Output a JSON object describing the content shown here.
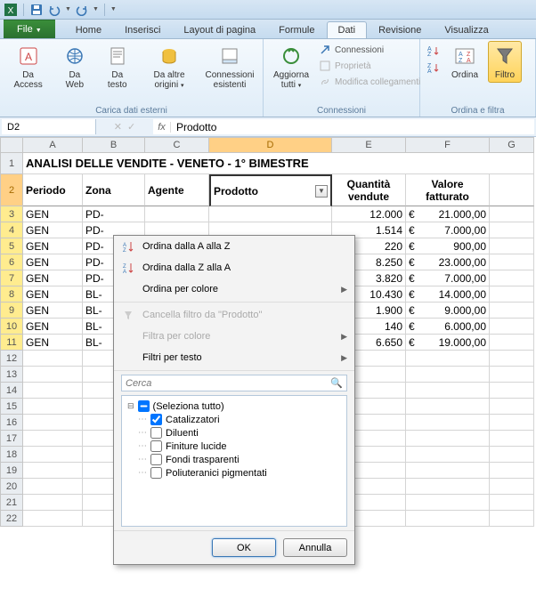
{
  "qat": {
    "save": "save",
    "undo": "undo",
    "redo": "redo"
  },
  "tabs": {
    "file": "File",
    "home": "Home",
    "inserisci": "Inserisci",
    "layout": "Layout di pagina",
    "formule": "Formule",
    "dati": "Dati",
    "revisione": "Revisione",
    "visualizza": "Visualizza"
  },
  "ribbon": {
    "group_carica": "Carica dati esterni",
    "group_connessioni": "Connessioni",
    "group_ordina": "Ordina e filtra",
    "da_access": "Da Access",
    "da_web": "Da Web",
    "da_testo": "Da testo",
    "da_altre": "Da altre origini",
    "conn_esistenti": "Connessioni esistenti",
    "aggiorna": "Aggiorna tutti",
    "connessioni": "Connessioni",
    "proprieta": "Proprietà",
    "modifica_coll": "Modifica collegamenti",
    "ordina": "Ordina",
    "filtro": "Filtro"
  },
  "namebox": "D2",
  "formula": "Prodotto",
  "columns": [
    "A",
    "B",
    "C",
    "D",
    "E",
    "F",
    "G"
  ],
  "sheet": {
    "title": "ANALISI DELLE VENDITE - VENETO - 1° BIMESTRE",
    "headers": {
      "periodo": "Periodo",
      "zona": "Zona",
      "agente": "Agente",
      "prodotto": "Prodotto",
      "qta_l1": "Quantità",
      "qta_l2": "vendute",
      "val_l1": "Valore",
      "val_l2": "fatturato"
    },
    "rows": [
      {
        "periodo": "GEN",
        "zona": "PD-",
        "qta": "12.000",
        "cur": "€",
        "val": "21.000,00"
      },
      {
        "periodo": "GEN",
        "zona": "PD-",
        "qta": "1.514",
        "cur": "€",
        "val": "7.000,00"
      },
      {
        "periodo": "GEN",
        "zona": "PD-",
        "qta": "220",
        "cur": "€",
        "val": "900,00"
      },
      {
        "periodo": "GEN",
        "zona": "PD-",
        "qta": "8.250",
        "cur": "€",
        "val": "23.000,00"
      },
      {
        "periodo": "GEN",
        "zona": "PD-",
        "qta": "3.820",
        "cur": "€",
        "val": "7.000,00"
      },
      {
        "periodo": "GEN",
        "zona": "BL-",
        "qta": "10.430",
        "cur": "€",
        "val": "14.000,00"
      },
      {
        "periodo": "GEN",
        "zona": "BL-",
        "qta": "1.900",
        "cur": "€",
        "val": "9.000,00"
      },
      {
        "periodo": "GEN",
        "zona": "BL-",
        "qta": "140",
        "cur": "€",
        "val": "6.000,00"
      },
      {
        "periodo": "GEN",
        "zona": "BL-",
        "qta": "6.650",
        "cur": "€",
        "val": "19.000,00"
      }
    ]
  },
  "filter": {
    "sort_az": "Ordina dalla A alla Z",
    "sort_za": "Ordina dalla Z alla A",
    "sort_color": "Ordina per colore",
    "clear": "Cancella filtro da \"Prodotto\"",
    "filter_color": "Filtra per colore",
    "filter_text": "Filtri per testo",
    "search": "Cerca",
    "items": [
      {
        "label": "(Seleziona tutto)",
        "checked": "indeterminate"
      },
      {
        "label": "Catalizzatori",
        "checked": true
      },
      {
        "label": "Diluenti",
        "checked": false
      },
      {
        "label": "Finiture lucide",
        "checked": false
      },
      {
        "label": "Fondi trasparenti",
        "checked": false
      },
      {
        "label": "Poliuteranici pigmentati",
        "checked": false
      }
    ],
    "ok": "OK",
    "cancel": "Annulla"
  }
}
